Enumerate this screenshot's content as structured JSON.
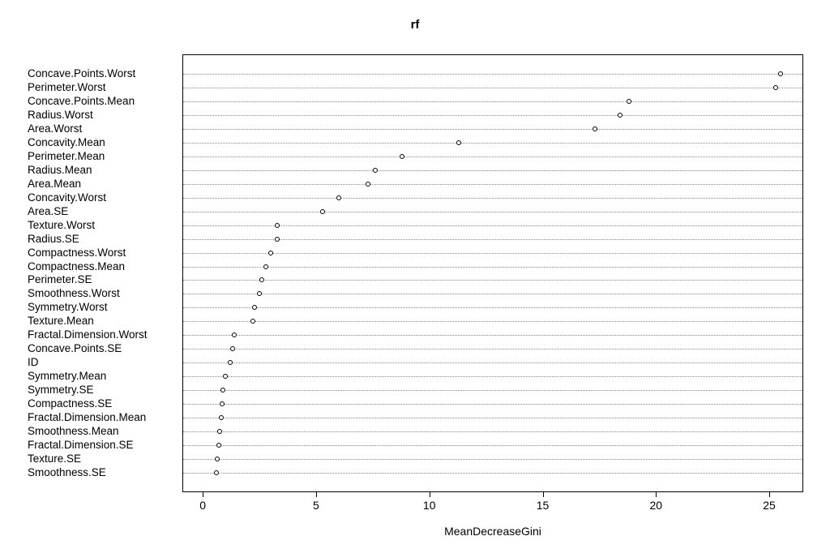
{
  "chart_data": {
    "type": "scatter",
    "title": "rf",
    "xlabel": "MeanDecreaseGini",
    "ylabel": "",
    "xlim": [
      -0.9,
      26.5
    ],
    "xticks": [
      0,
      5,
      10,
      15,
      20,
      25
    ],
    "categories": [
      "Concave.Points.Worst",
      "Perimeter.Worst",
      "Concave.Points.Mean",
      "Radius.Worst",
      "Area.Worst",
      "Concavity.Mean",
      "Perimeter.Mean",
      "Radius.Mean",
      "Area.Mean",
      "Concavity.Worst",
      "Area.SE",
      "Texture.Worst",
      "Radius.SE",
      "Compactness.Worst",
      "Compactness.Mean",
      "Perimeter.SE",
      "Smoothness.Worst",
      "Symmetry.Worst",
      "Texture.Mean",
      "Fractal.Dimension.Worst",
      "Concave.Points.SE",
      "ID",
      "Symmetry.Mean",
      "Symmetry.SE",
      "Compactness.SE",
      "Fractal.Dimension.Mean",
      "Smoothness.Mean",
      "Fractal.Dimension.SE",
      "Texture.SE",
      "Smoothness.SE"
    ],
    "values": [
      25.5,
      25.3,
      18.8,
      18.4,
      17.3,
      11.3,
      8.8,
      7.6,
      7.3,
      6.0,
      5.3,
      3.3,
      3.3,
      3.0,
      2.8,
      2.6,
      2.5,
      2.3,
      2.2,
      1.4,
      1.3,
      1.2,
      1.0,
      0.9,
      0.85,
      0.8,
      0.75,
      0.7,
      0.65,
      0.6
    ]
  }
}
